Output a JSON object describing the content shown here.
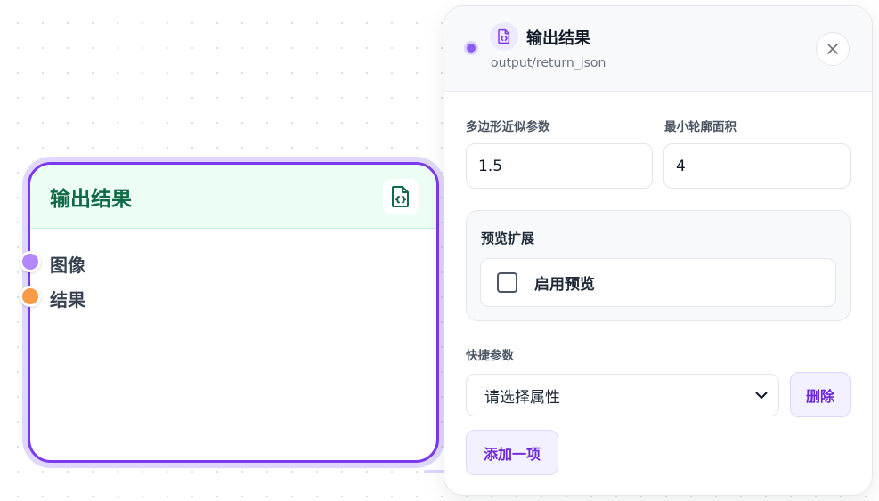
{
  "node": {
    "title": "输出结果",
    "icon": "file-code-icon",
    "inputs": [
      {
        "label": "图像",
        "color": "#b388ff"
      },
      {
        "label": "结果",
        "color": "#fb9b47"
      }
    ]
  },
  "panel": {
    "title": "输出结果",
    "subtitle": "output/return_json",
    "icon": "file-code-icon",
    "fields": {
      "epsilon": {
        "label": "多边形近似参数",
        "value": "1.5"
      },
      "min_area": {
        "label": "最小轮廓面积",
        "value": "4"
      }
    },
    "preview_group": {
      "title": "预览扩展",
      "checkbox_label": "启用预览",
      "checked": false
    },
    "quick_params": {
      "label": "快捷参数",
      "select_value": "请选择属性",
      "delete_label": "删除",
      "add_label": "添加一项"
    }
  },
  "colors": {
    "accent": "#7c3aed",
    "node_header_bg": "#ecfdf3",
    "node_title": "#0f6a45"
  }
}
